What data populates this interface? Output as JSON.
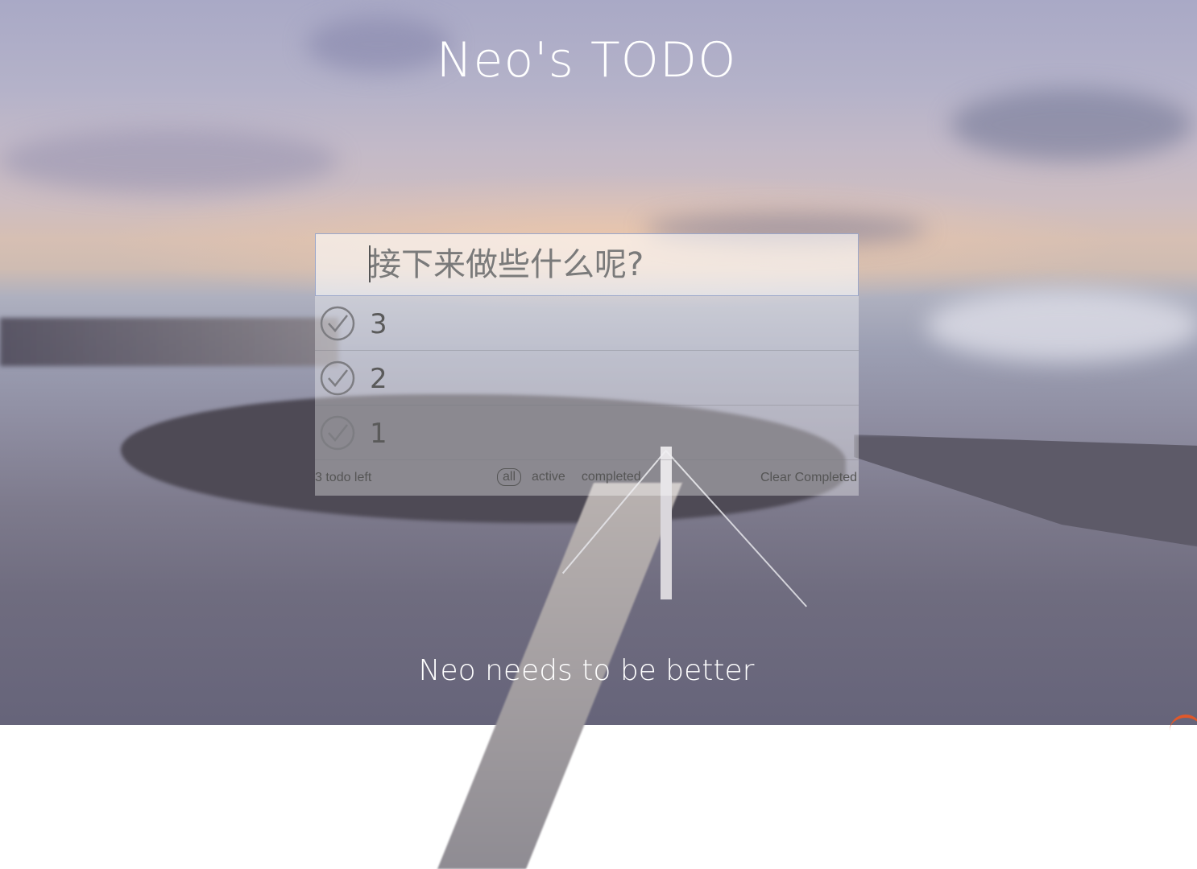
{
  "app": {
    "title": "Neo's TODO",
    "tagline": "Neo needs to be better"
  },
  "input": {
    "placeholder": "接下来做些什么呢?",
    "value": ""
  },
  "todos": [
    {
      "label": "3",
      "completed": false
    },
    {
      "label": "2",
      "completed": false
    },
    {
      "label": "1",
      "completed": false
    }
  ],
  "footer": {
    "count_text": "3 todo left",
    "filters": [
      "all",
      "active",
      "completed"
    ],
    "selected_filter": "all",
    "clear_label": "Clear Completed"
  },
  "colors": {
    "accent_border": "#9aa6c9",
    "text": "#555555",
    "title": "#ffffff"
  }
}
